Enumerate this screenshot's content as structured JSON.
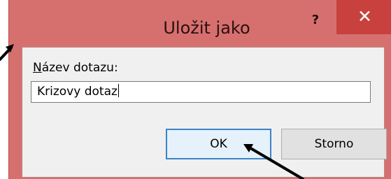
{
  "dialog": {
    "title": "Uložit jako",
    "help_label": "?",
    "close_label": "✕",
    "field_label_mnemonic": "N",
    "field_label_rest": "ázev dotazu:",
    "input_value": "Krizovy dotaz",
    "ok_label": "OK",
    "cancel_label": "Storno"
  },
  "colors": {
    "dialog_frame": "#d6706f",
    "close_button": "#c8413e",
    "content_background": "#f0f0f0",
    "ok_button_border": "#3c84c8"
  },
  "annotations": {
    "pointer_arrows": 2
  }
}
